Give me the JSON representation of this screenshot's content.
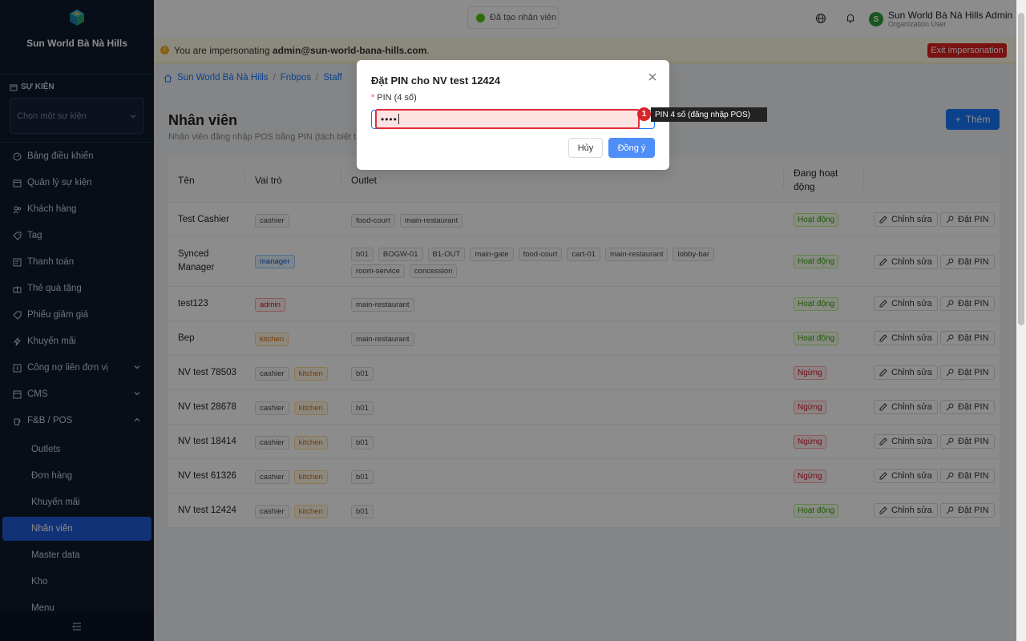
{
  "sidebar": {
    "brand": "Sun World Bà Nà Hills",
    "event_section": "SỰ KIỆN",
    "event_placeholder": "Chọn một sự kiện",
    "items": [
      {
        "label": "Bảng điều khiển",
        "icon": "dashboard-icon"
      },
      {
        "label": "Quản lý sự kiện",
        "icon": "calendar-icon"
      },
      {
        "label": "Khách hàng",
        "icon": "users-icon"
      },
      {
        "label": "Tag",
        "icon": "tag-icon"
      },
      {
        "label": "Thanh toán",
        "icon": "payment-icon"
      },
      {
        "label": "Thẻ quà tặng",
        "icon": "gift-icon"
      },
      {
        "label": "Phiếu giảm giá",
        "icon": "coupon-icon"
      },
      {
        "label": "Khuyến mãi",
        "icon": "promo-icon"
      },
      {
        "label": "Công nợ liên đơn vị",
        "icon": "debt-icon"
      },
      {
        "label": "CMS",
        "icon": "cms-icon"
      },
      {
        "label": "F&B / POS",
        "icon": "coffee-icon"
      }
    ],
    "subitems": [
      "Outlets",
      "Đơn hàng",
      "Khuyến mãi",
      "Nhân viên",
      "Master data",
      "Kho",
      "Menu"
    ],
    "active_subitem": "Nhân viên"
  },
  "header": {
    "toast": "Đã tạo nhân viên",
    "user_name": "Sun World Bà Nà Hills Admin",
    "user_role": "Organization User",
    "avatar_letter": "S"
  },
  "impersonation": {
    "prefix": "You are impersonating ",
    "email": "admin@sun-world-bana-hills.com",
    "suffix": ".",
    "exit_label": "Exit impersonation"
  },
  "breadcrumb": [
    "Sun World Bà Nà Hills",
    "Fnbpos",
    "Staff"
  ],
  "page": {
    "title": "Nhân viên",
    "subtitle": "Nhân viên đăng nhập POS bằng PIN (tách biệt tài k",
    "add_label": "Thêm"
  },
  "table": {
    "columns": [
      "Tên",
      "Vai trò",
      "Outlet",
      "Đang hoạt động"
    ],
    "edit_label": "Chỉnh sửa",
    "pin_label": "Đặt PIN",
    "rows": [
      {
        "name": "Test Cashier",
        "roles": [
          "cashier"
        ],
        "outlets": [
          "food-court",
          "main-restaurant"
        ],
        "status": "Hoạt động",
        "active": true
      },
      {
        "name": "Synced Manager",
        "roles": [
          "manager"
        ],
        "outlets": [
          "b01",
          "BOGW-01",
          "B1-OUT",
          "main-gate",
          "food-court",
          "cart-01",
          "main-restaurant",
          "lobby-bar",
          "room-service",
          "concession"
        ],
        "status": "Hoạt động",
        "active": true
      },
      {
        "name": "test123",
        "roles": [
          "admin"
        ],
        "outlets": [
          "main-restaurant"
        ],
        "status": "Hoạt động",
        "active": true
      },
      {
        "name": "Bep",
        "roles": [
          "kitchen"
        ],
        "outlets": [
          "main-restaurant"
        ],
        "status": "Hoạt động",
        "active": true
      },
      {
        "name": "NV test 78503",
        "roles": [
          "cashier",
          "kitchen"
        ],
        "outlets": [
          "b01"
        ],
        "status": "Ngừng",
        "active": false
      },
      {
        "name": "NV test 28678",
        "roles": [
          "cashier",
          "kitchen"
        ],
        "outlets": [
          "b01"
        ],
        "status": "Ngừng",
        "active": false
      },
      {
        "name": "NV test 18414",
        "roles": [
          "cashier",
          "kitchen"
        ],
        "outlets": [
          "b01"
        ],
        "status": "Ngừng",
        "active": false
      },
      {
        "name": "NV test 61326",
        "roles": [
          "cashier",
          "kitchen"
        ],
        "outlets": [
          "b01"
        ],
        "status": "Ngừng",
        "active": false
      },
      {
        "name": "NV test 12424",
        "roles": [
          "cashier",
          "kitchen"
        ],
        "outlets": [
          "b01"
        ],
        "status": "Hoạt động",
        "active": true
      }
    ]
  },
  "modal": {
    "title": "Đặt PIN cho NV test 12424",
    "field_label": "PIN (4 số)",
    "value": "••••",
    "cancel_label": "Hủy",
    "ok_label": "Đồng ý"
  },
  "annotation": {
    "badge": "1",
    "tooltip": "PIN 4 số (đăng nhập POS)"
  }
}
